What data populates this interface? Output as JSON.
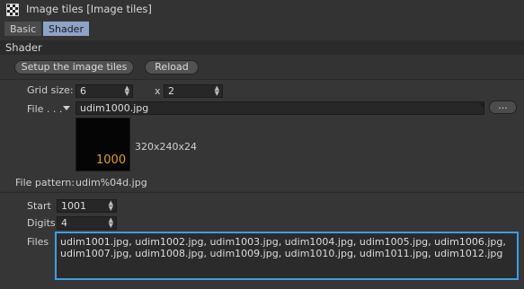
{
  "window": {
    "title": "Image tiles [Image tiles]"
  },
  "tabs": [
    {
      "label": "Basic"
    },
    {
      "label": "Shader"
    }
  ],
  "section": {
    "title": "Shader"
  },
  "buttons": {
    "setup": "Setup the image tiles",
    "reload": "Reload"
  },
  "grid": {
    "label": "Grid size:",
    "x_value": "6",
    "times": "x",
    "y_value": "2"
  },
  "file": {
    "label": "File . . .",
    "value": "udim1000.jpg",
    "browse": "..."
  },
  "preview": {
    "number": "1000",
    "info": "320x240x24"
  },
  "pattern": {
    "label": "File pattern:",
    "value": "udim%04d.jpg"
  },
  "start": {
    "label": "Start",
    "value": "1001"
  },
  "digits": {
    "label": "Digits",
    "value": "4"
  },
  "files": {
    "label": "Files",
    "line1": "udim1001.jpg, udim1002.jpg, udim1003.jpg, udim1004.jpg, udim1005.jpg, udim1006.jpg,",
    "line2": "udim1007.jpg, udim1008.jpg, udim1009.jpg, udim1010.jpg, udim1011.jpg, udim1012.jpg"
  },
  "colors": {
    "selected_tab": "#8ea3c7",
    "focus_border": "#3e9ee3",
    "preview_text": "#e2a020"
  }
}
